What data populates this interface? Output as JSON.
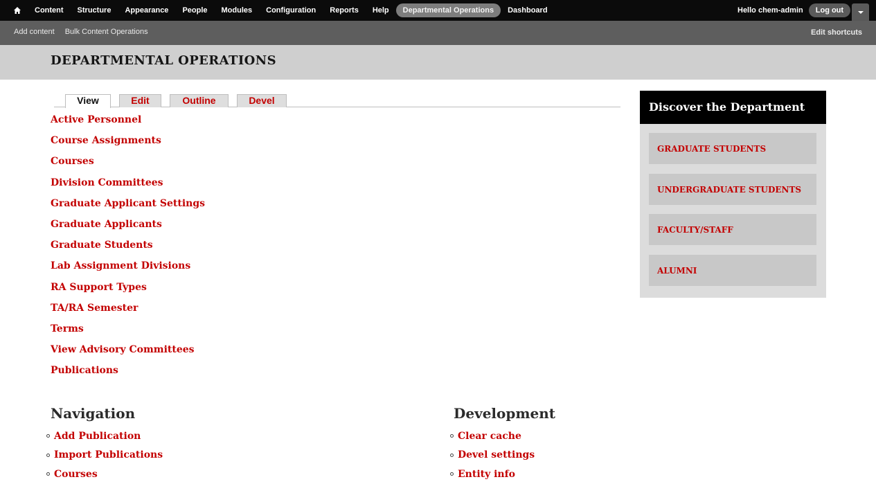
{
  "toolbar": {
    "items": [
      "Content",
      "Structure",
      "Appearance",
      "People",
      "Modules",
      "Configuration",
      "Reports",
      "Help",
      "Departmental Operations",
      "Dashboard"
    ],
    "active_item": "Departmental Operations",
    "greeting": "Hello chem-admin",
    "logout_label": "Log out"
  },
  "shortcuts": {
    "links": [
      "Add content",
      "Bulk Content Operations"
    ],
    "edit_label": "Edit shortcuts"
  },
  "page": {
    "title": "DEPARTMENTAL OPERATIONS",
    "tabs": [
      "View",
      "Edit",
      "Outline",
      "Devel"
    ],
    "active_tab": "View",
    "links": [
      "Active Personnel",
      "Course Assignments",
      "Courses",
      "Division Committees",
      "Graduate Applicant Settings",
      "Graduate Applicants",
      "Graduate Students",
      "Lab Assignment Divisions",
      "RA Support Types",
      "TA/RA Semester",
      "Terms",
      "View Advisory Committees",
      "Publications"
    ]
  },
  "sidebar": {
    "title": "Discover the Department",
    "items": [
      "GRADUATE STUDENTS",
      "UNDERGRADUATE STUDENTS",
      "FACULTY/STAFF",
      "ALUMNI"
    ]
  },
  "navigation": {
    "title": "Navigation",
    "items": [
      "Add Publication",
      "Import Publications",
      "Courses"
    ]
  },
  "development": {
    "title": "Development",
    "items": [
      "Clear cache",
      "Devel settings",
      "Entity info"
    ]
  },
  "colors": {
    "link": "#c30000",
    "toolbar": "#0b0b0b",
    "shortcut_bar": "#5e5e5e",
    "header_band": "#cfcfcf",
    "sidebar_bg": "#dcdcdc"
  }
}
